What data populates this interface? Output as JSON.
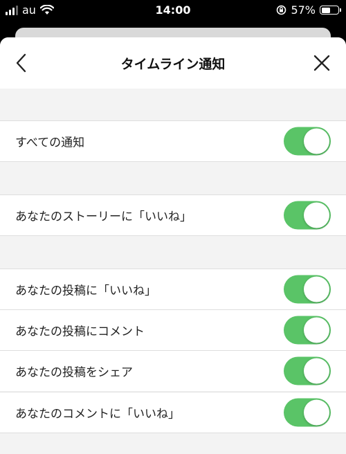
{
  "status_bar": {
    "carrier": "au",
    "time": "14:00",
    "battery": "57%",
    "battery_level": 0.57
  },
  "header": {
    "title": "タイムライン通知"
  },
  "settings": {
    "all": {
      "label": "すべての通知",
      "on": true
    },
    "story_like": {
      "label": "あなたのストーリーに「いいね」",
      "on": true
    },
    "post_like": {
      "label": "あなたの投稿に「いいね」",
      "on": true
    },
    "post_comment": {
      "label": "あなたの投稿にコメント",
      "on": true
    },
    "post_share": {
      "label": "あなたの投稿をシェア",
      "on": true
    },
    "comment_like": {
      "label": "あなたのコメントに「いいね」",
      "on": true
    }
  },
  "colors": {
    "toggle_on": "#5ac467",
    "section_bg": "#f3f3f3"
  }
}
